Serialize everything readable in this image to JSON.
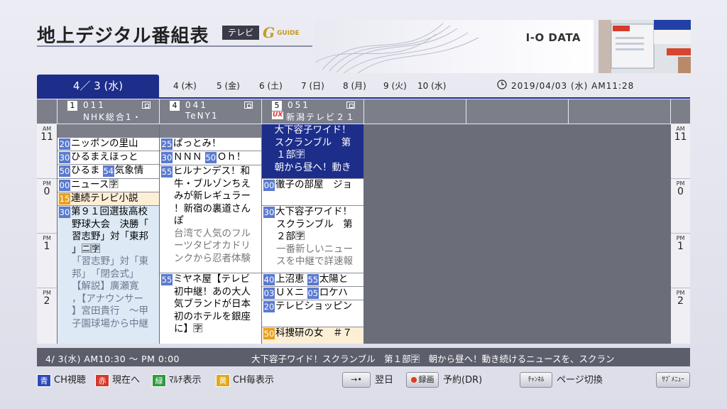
{
  "header": {
    "title": "地上デジタル番組表",
    "tv_badge": "テレビ",
    "gguide_g": "G",
    "gguide_text": "GUIDE",
    "banner_logo": "I-O DATA"
  },
  "dates": {
    "active": "4／ 3 (水)",
    "tabs": [
      "4 (木)",
      "5 (金)",
      "6 (土)",
      "7 (日)",
      "8 (月)",
      "9 (火)",
      "10 (水)"
    ],
    "clock": "2019/04/03 (水)   AM11:28"
  },
  "channels": [
    {
      "num": "1",
      "code": "011",
      "name": "NHK総合1・"
    },
    {
      "num": "4",
      "code": "041",
      "name": "TeNY1"
    },
    {
      "num": "5",
      "code": "051",
      "name": "新潟テレビ２１",
      "logo": "UX"
    }
  ],
  "hours": [
    {
      "ampm": "AM",
      "hour": "11"
    },
    {
      "ampm": "PM",
      "hour": "0"
    },
    {
      "ampm": "PM",
      "hour": "1"
    },
    {
      "ampm": "PM",
      "hour": "2"
    }
  ],
  "programs": {
    "nhk": [
      {
        "min": "20",
        "title": "ニッポンの里山"
      },
      {
        "min": "30",
        "title": "ひるまえほっと"
      },
      {
        "min": "50",
        "title": "ひるま",
        "min2": "54",
        "title2": "気象情"
      },
      {
        "min": "00",
        "title": "ニュース🈑"
      },
      {
        "min": "15",
        "title": "連続テレビ小説"
      },
      {
        "min": "30",
        "title": "第９１回選抜高校",
        "lines": [
          "野球大会　決勝「",
          "習志野」対「東邦",
          "」🈔🈑"
        ],
        "desc": [
          "「習志野」対「東",
          "邦」　「閉会式」",
          "【解説】廣瀬寛",
          "，【アナウンサー",
          "】宮田貴行　～甲",
          "子園球場から中継"
        ]
      }
    ],
    "teny": [
      {
        "min": "25",
        "title": "ぱっとみ！"
      },
      {
        "min": "30",
        "title": "ＮＮＮ",
        "min2": "50",
        "title2": "Ｏｈ！"
      },
      {
        "min": "55",
        "title": "ヒルナンデス！和",
        "lines": [
          "牛・ブルゾンちえ",
          "みが新レギュラー",
          "！新宿の裏道さん",
          "ぽ"
        ],
        "desc": [
          "台湾で人気のフル",
          "ーツタピオカドリ",
          "ンクから忍者体験"
        ]
      },
      {
        "min": "55",
        "title": "ミヤネ屋【テレビ",
        "lines": [
          "初中継！あの大人",
          "気ブランドが日本",
          "初のホテルを銀座",
          "に】🈑"
        ]
      }
    ],
    "ux": [
      {
        "title": "大下容子ワイド！",
        "lines": [
          "スクランブル　第",
          "１部🈑",
          "朝から昼へ！動き"
        ]
      },
      {
        "min": "00",
        "title": "徹子の部屋　ジョ"
      },
      {
        "min": "30",
        "title": "大下容子ワイド！",
        "lines": [
          "スクランブル　第",
          "２部🈑"
        ],
        "desc": [
          "一番新しいニュー",
          "スを中継で詳速報"
        ]
      },
      {
        "min": "40",
        "title": "上沼恵",
        "min2": "55",
        "title2": "太陽と"
      },
      {
        "min": "03",
        "title": "ＵＸニ",
        "min2": "05",
        "title2": "ロケハ"
      },
      {
        "min": "20",
        "title": "テレビショッピン"
      },
      {
        "min": "50",
        "title": "科捜研の女　＃７"
      }
    ]
  },
  "info_bar": {
    "time": "4/ 3(水)   AM10:30 ～ PM 0:00",
    "title": "大下容子ワイド！スクランブル　第１部🈑　朝から昼へ！動き続けるニュースを、スクラン"
  },
  "footer": {
    "blue_key": "青",
    "blue_label": "CH視聴",
    "red_key": "赤",
    "red_label": "現在へ",
    "green_key": "緑",
    "green_label": "ﾏﾙﾁ表示",
    "yellow_key": "黄",
    "yellow_label": "CH毎表示",
    "next_day_btn": "→•",
    "next_day_label": "翌日",
    "rec_btn": "録画",
    "rec_label": "予約(DR)",
    "channel_btn": "ﾁｬﾝﾈﾙ",
    "channel_label": "ページ切換",
    "submenu_btn": "ｻﾌﾞﾒﾆｭｰ"
  },
  "colors": {
    "accent": "#1d2d8a",
    "key_blue": "#2c49b8",
    "key_red": "#d23a2a",
    "key_green": "#2f9a3f",
    "key_yellow": "#e0a81c"
  }
}
